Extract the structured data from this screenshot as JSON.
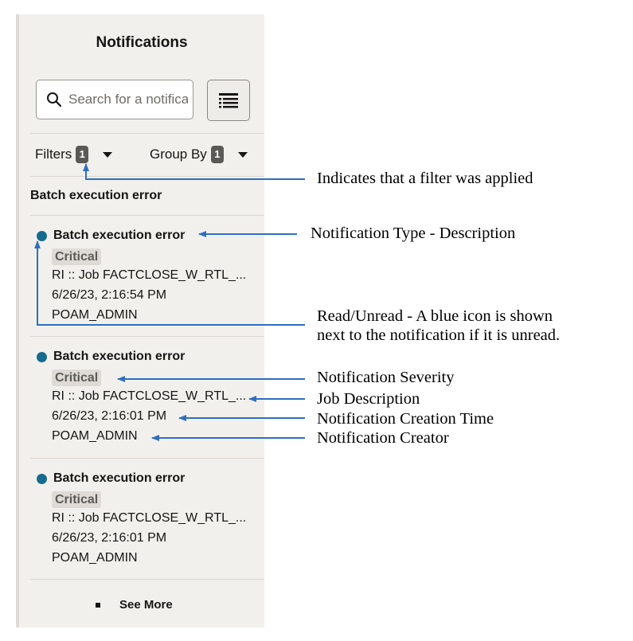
{
  "panel": {
    "title": "Notifications",
    "search": {
      "placeholder": "Search for a notification",
      "value": ""
    },
    "filters": {
      "label": "Filters",
      "count": "1"
    },
    "group_by": {
      "label": "Group By",
      "count": "1"
    },
    "group_heading": "Batch execution error",
    "see_more": "See More"
  },
  "notifications": [
    {
      "title": "Batch execution error",
      "severity": "Critical",
      "description": "RI :: Job FACTCLOSE_W_RTL_...",
      "time": "6/26/23, 2:16:54 PM",
      "creator": "POAM_ADMIN",
      "unread": true
    },
    {
      "title": "Batch execution error",
      "severity": "Critical",
      "description": "RI :: Job FACTCLOSE_W_RTL_...",
      "time": "6/26/23, 2:16:01 PM",
      "creator": "POAM_ADMIN",
      "unread": true
    },
    {
      "title": "Batch execution error",
      "severity": "Critical",
      "description": "RI :: Job FACTCLOSE_W_RTL_...",
      "time": "6/26/23, 2:16:01 PM",
      "creator": "POAM_ADMIN",
      "unread": true
    }
  ],
  "annotations": {
    "filter_applied": "Indicates that a filter was applied",
    "type_description": "Notification Type - Description",
    "read_unread_line1": "Read/Unread - A blue icon is shown",
    "read_unread_line2": "next to the notification if it is unread.",
    "severity": "Notification Severity",
    "job_description": "Job Description",
    "creation_time": "Notification Creation Time",
    "creator": "Notification Creator"
  },
  "colors": {
    "panel_bg": "#f2f0ed",
    "unread_dot": "#176a8f",
    "severity_badge": "#dedbd6",
    "count_badge": "#5b5956",
    "annotation_arrow": "#2e6fc0"
  },
  "icons": {
    "search": "search-icon",
    "list_view": "list-view-icon",
    "filter_caret": "chevron-down-icon",
    "group_caret": "chevron-down-icon",
    "unread": "unread-dot-icon",
    "see_more": "square-bullet-icon"
  }
}
